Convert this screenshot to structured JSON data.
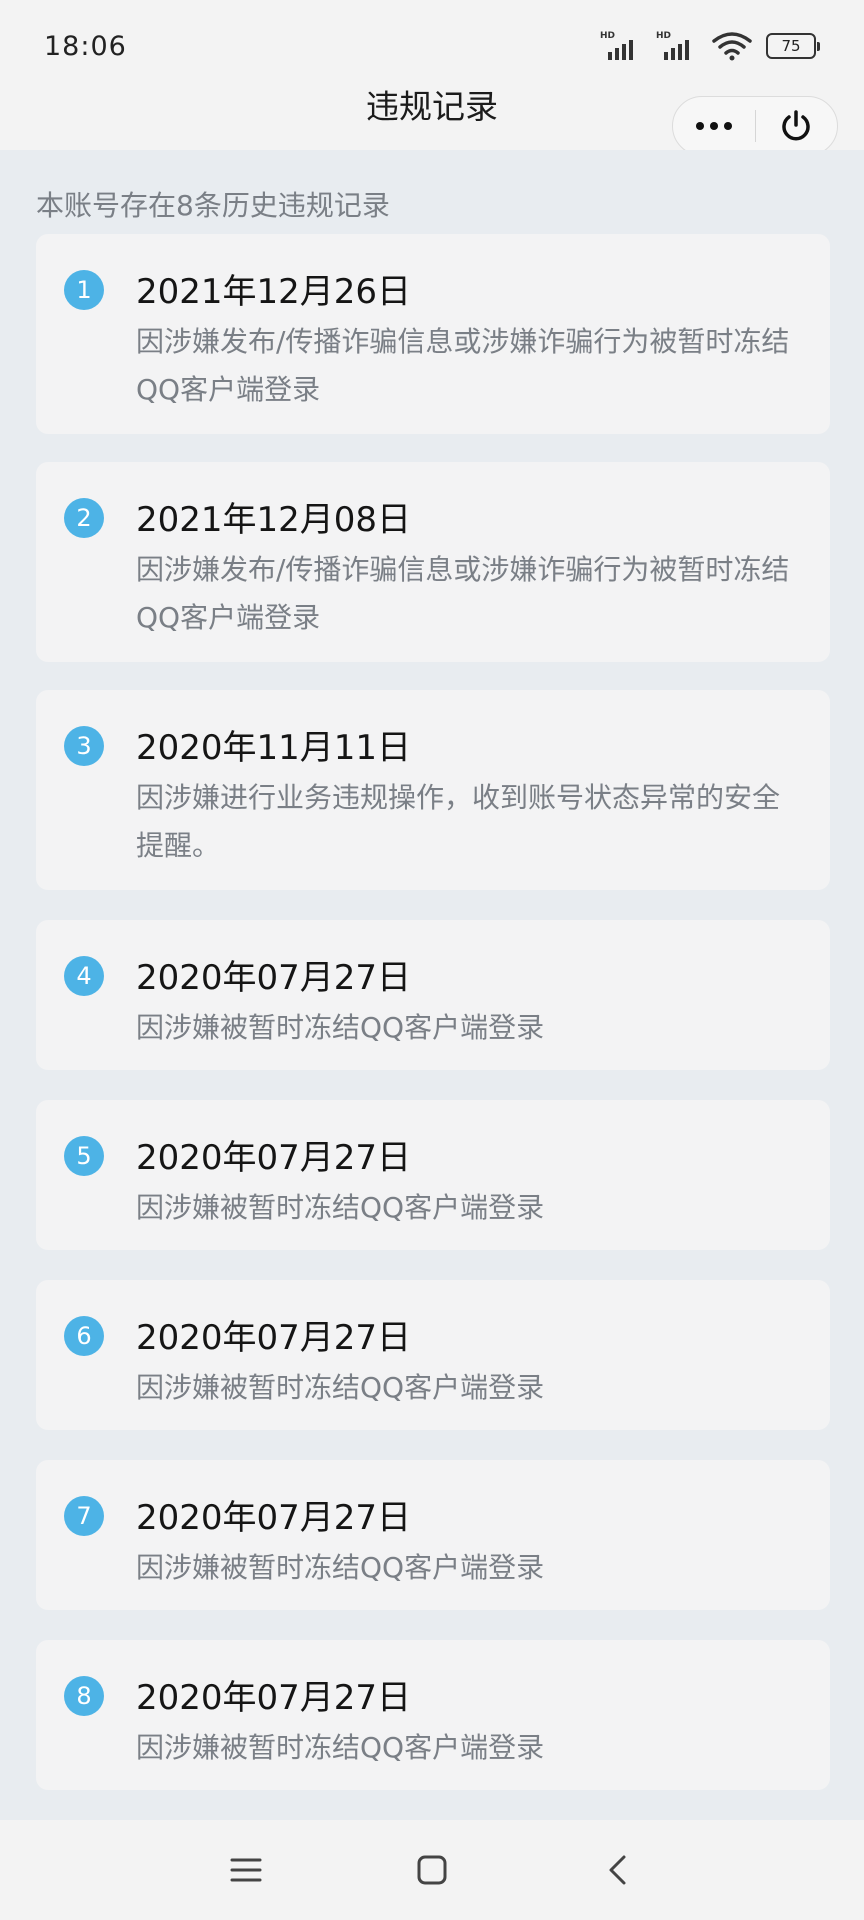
{
  "status_bar": {
    "time": "18:06",
    "battery": "75",
    "network_label": "HD"
  },
  "header": {
    "title": "违规记录"
  },
  "summary": "本账号存在8条历史违规记录",
  "records": [
    {
      "index": "1",
      "date": "2021年12月26日",
      "description": "因涉嫌发布/传播诈骗信息或涉嫌诈骗行为被暂时冻结QQ客户端登录"
    },
    {
      "index": "2",
      "date": "2021年12月08日",
      "description": "因涉嫌发布/传播诈骗信息或涉嫌诈骗行为被暂时冻结QQ客户端登录"
    },
    {
      "index": "3",
      "date": "2020年11月11日",
      "description": "因涉嫌进行业务违规操作，收到账号状态异常的安全提醒。"
    },
    {
      "index": "4",
      "date": "2020年07月27日",
      "description": "因涉嫌被暂时冻结QQ客户端登录"
    },
    {
      "index": "5",
      "date": "2020年07月27日",
      "description": "因涉嫌被暂时冻结QQ客户端登录"
    },
    {
      "index": "6",
      "date": "2020年07月27日",
      "description": "因涉嫌被暂时冻结QQ客户端登录"
    },
    {
      "index": "7",
      "date": "2020年07月27日",
      "description": "因涉嫌被暂时冻结QQ客户端登录"
    },
    {
      "index": "8",
      "date": "2020年07月27日",
      "description": "因涉嫌被暂时冻结QQ客户端登录"
    }
  ],
  "icons": {
    "more": "more-dots-icon",
    "close": "power-icon",
    "nav_menu": "menu-icon",
    "nav_home": "home-square-icon",
    "nav_back": "back-chevron-icon"
  },
  "colors": {
    "badge": "#4db3e6",
    "card": "#f3f3f4",
    "background": "#e8ecf0",
    "secondary_text": "#7a7f86"
  }
}
